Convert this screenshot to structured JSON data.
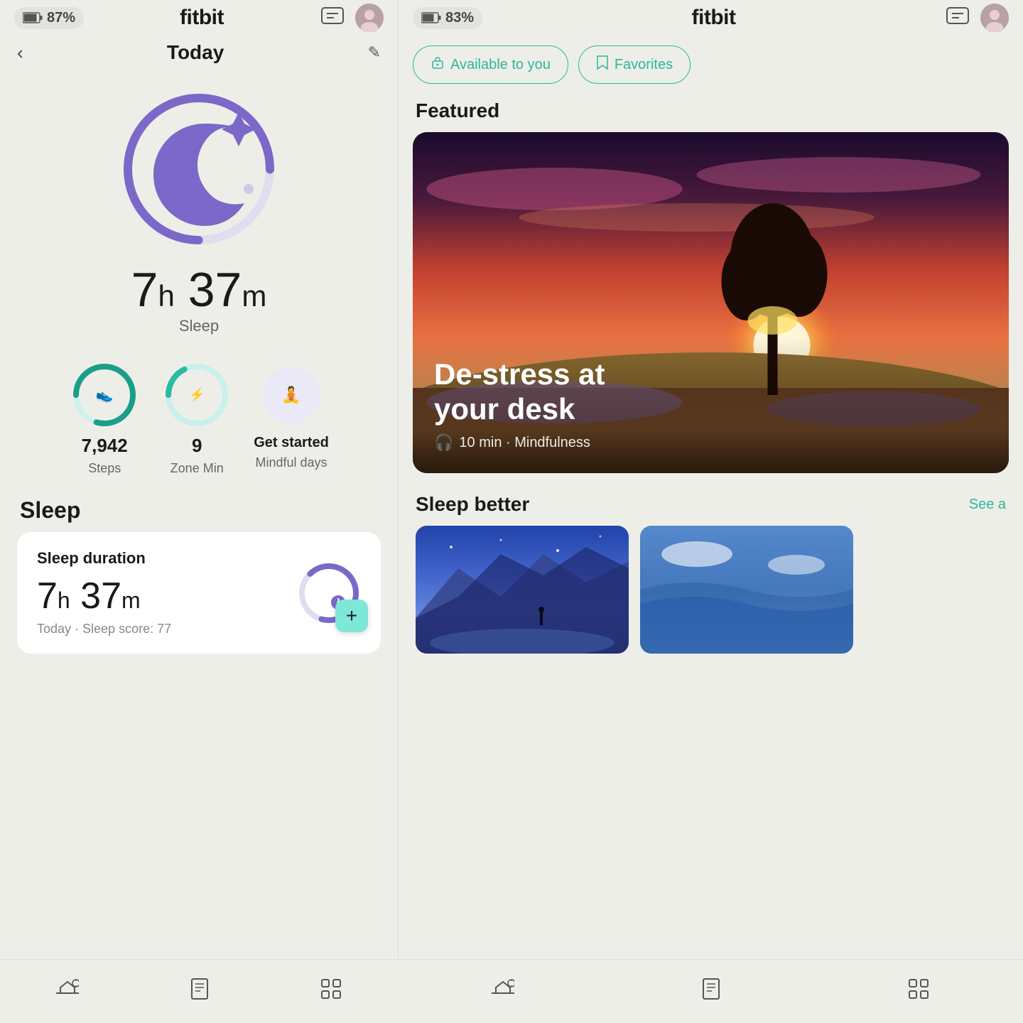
{
  "left": {
    "status": {
      "battery_pct": "87%",
      "app_name": "fitbit"
    },
    "header": {
      "back_label": "‹",
      "title": "Today",
      "edit_label": "✎"
    },
    "sleep_ring": {
      "hours": "7",
      "minutes": "37",
      "unit_h": "h",
      "unit_m": "m",
      "label": "Sleep"
    },
    "metrics": [
      {
        "id": "steps",
        "value": "7,942",
        "label": "Steps",
        "icon": "👟",
        "color": "#1a9e8a",
        "ring_color": "#1a9e8a",
        "pct": 79
      },
      {
        "id": "zone-min",
        "value": "9",
        "label": "Zone Min",
        "icon": "⚡",
        "color": "#2abba0",
        "ring_color": "#2abba0",
        "pct": 18
      },
      {
        "id": "mindful",
        "value": "Get started",
        "label": "Mindful days",
        "icon": "🧘",
        "color": "#9b8ec8",
        "ring_color": "#b0a8d8",
        "pct": 0
      }
    ],
    "sleep_section": {
      "section_label": "Sleep",
      "card": {
        "title": "Sleep duration",
        "hours": "7",
        "minutes": "37",
        "unit_h": "h",
        "unit_m": "m",
        "sub": "Today · Sleep score: 77",
        "plus_label": "+"
      }
    },
    "bottom_nav": [
      {
        "id": "today",
        "icon": "🌄"
      },
      {
        "id": "log",
        "icon": "📋"
      },
      {
        "id": "apps",
        "icon": "⊞"
      }
    ]
  },
  "right": {
    "status": {
      "battery_pct": "83%",
      "app_name": "fitbit"
    },
    "filter_tabs": [
      {
        "id": "available",
        "icon": "🔓",
        "label": "Available to you",
        "active": true
      },
      {
        "id": "favorites",
        "icon": "🔖",
        "label": "Favorites",
        "active": false
      }
    ],
    "featured": {
      "section_label": "Featured",
      "card": {
        "title": "De-stress at\nyour desk",
        "meta_icon": "🎧",
        "meta_text": "10 min · Mindfulness"
      }
    },
    "sleep_better": {
      "section_label": "Sleep better",
      "see_all_label": "See a"
    },
    "bottom_nav": [
      {
        "id": "today",
        "icon": "🌄"
      },
      {
        "id": "log",
        "icon": "📋"
      },
      {
        "id": "apps",
        "icon": "⊞"
      }
    ]
  }
}
